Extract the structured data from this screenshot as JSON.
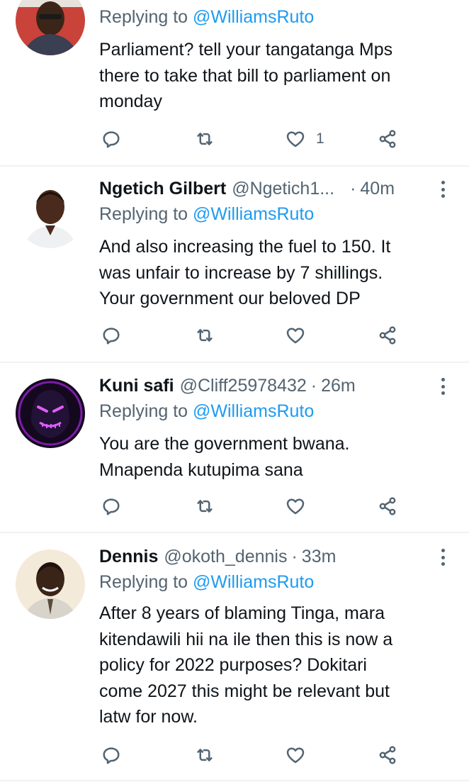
{
  "common": {
    "replying_prefix": "Replying to",
    "mention": "@WilliamsRuto",
    "dot": "·"
  },
  "tweets": [
    {
      "avatar": "profile-photo",
      "body_lines": [
        "Parliament? tell your tangatanga Mps",
        "there to take that bill to parliament on",
        "monday"
      ],
      "likes": "1"
    },
    {
      "name": "Ngetich Gilbert",
      "handle": "@Ngetich1...",
      "time": "40m",
      "avatar": "profile-photo",
      "body_lines": [
        "And also increasing the fuel to 150. It",
        "was unfair to increase by 7 shillings.",
        "Your government our beloved DP"
      ]
    },
    {
      "name": "Kuni safi",
      "handle": "@Cliff25978432",
      "time": "26m",
      "avatar": "neon-mask-photo",
      "body_lines": [
        "You are the government bwana.",
        "Mnapenda kutupima sana"
      ]
    },
    {
      "name": "Dennis",
      "handle": "@okoth_dennis",
      "time": "33m",
      "avatar": "profile-photo",
      "body_lines": [
        "After 8 years of blaming Tinga, mara",
        "kitendawili hii na ile then this is now a",
        "policy for 2022 purposes? Dokitari",
        "come 2027 this might be relevant but",
        "latw for now."
      ]
    }
  ],
  "icons": {
    "reply": "reply-icon",
    "retweet": "retweet-icon",
    "like": "heart-icon",
    "share": "share-icon",
    "more": "more-icon"
  },
  "colors": {
    "mention": "#1d9bf0",
    "secondary_text": "#536471",
    "divider": "#eff3f4"
  }
}
